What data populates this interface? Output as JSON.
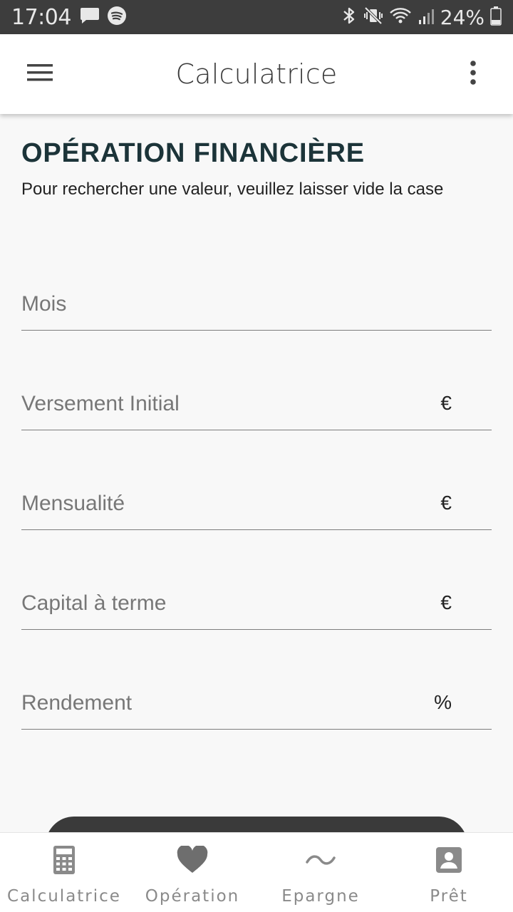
{
  "status_bar": {
    "time": "17:04",
    "battery": "24%",
    "icons": [
      "message-icon",
      "spotify-icon",
      "bluetooth-icon",
      "vibrate-icon",
      "wifi-icon",
      "signal-icon",
      "battery-icon"
    ]
  },
  "app_bar": {
    "title": "Calculatrice",
    "menu_icon": "hamburger-menu-icon",
    "more_icon": "more-vert-icon"
  },
  "main": {
    "title": "OPÉRATION FINANCIÈRE",
    "subtitle": "Pour rechercher une valeur, veuillez laisser vide la case",
    "fields": [
      {
        "label": "Mois",
        "suffix": ""
      },
      {
        "label": "Versement Initial",
        "suffix": "€"
      },
      {
        "label": "Mensualité",
        "suffix": "€"
      },
      {
        "label": "Capital à terme",
        "suffix": "€"
      },
      {
        "label": "Rendement",
        "suffix": "%"
      }
    ]
  },
  "bottom_nav": {
    "items": [
      {
        "label": "Calculatrice",
        "icon": "calculator-icon"
      },
      {
        "label": "Opération",
        "icon": "heart-icon"
      },
      {
        "label": "Epargne",
        "icon": "tilde-icon"
      },
      {
        "label": "Prêt",
        "icon": "account-box-icon"
      }
    ]
  },
  "colors": {
    "status_bar": "#3d3d3d",
    "title": "#1c3439",
    "nav_inactive": "#8a8a8a",
    "background": "#f8f8f8"
  }
}
